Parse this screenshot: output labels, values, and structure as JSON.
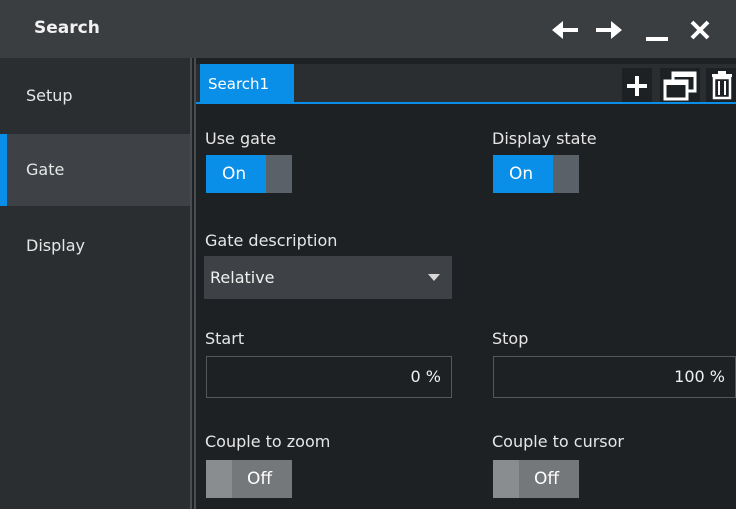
{
  "window": {
    "title": "Search",
    "controls": [
      "arrow-left-icon",
      "arrow-right-icon",
      "minimize-icon",
      "close-icon"
    ]
  },
  "sidebar": {
    "items": [
      {
        "label": "Setup",
        "active": false
      },
      {
        "label": "Gate",
        "active": true
      },
      {
        "label": "Display",
        "active": false
      }
    ]
  },
  "tabs": {
    "items": [
      {
        "label": "Search1",
        "active": true
      }
    ],
    "tools": [
      "add-icon",
      "copy-icon",
      "delete-icon"
    ]
  },
  "gate": {
    "use_gate": {
      "label": "Use gate",
      "state": "On"
    },
    "display_state": {
      "label": "Display state",
      "state": "On"
    },
    "gate_description": {
      "label": "Gate description",
      "value": "Relative"
    },
    "start": {
      "label": "Start",
      "value": "0 %"
    },
    "stop": {
      "label": "Stop",
      "value": "100 %"
    },
    "couple_to_zoom": {
      "label": "Couple to zoom",
      "state": "Off"
    },
    "couple_to_cursor": {
      "label": "Couple to cursor",
      "state": "Off"
    }
  },
  "colors": {
    "accent": "#0a8fe8",
    "titlebar": "#3b3e41",
    "sidebar": "#2b2e31",
    "background": "#1e2124"
  }
}
